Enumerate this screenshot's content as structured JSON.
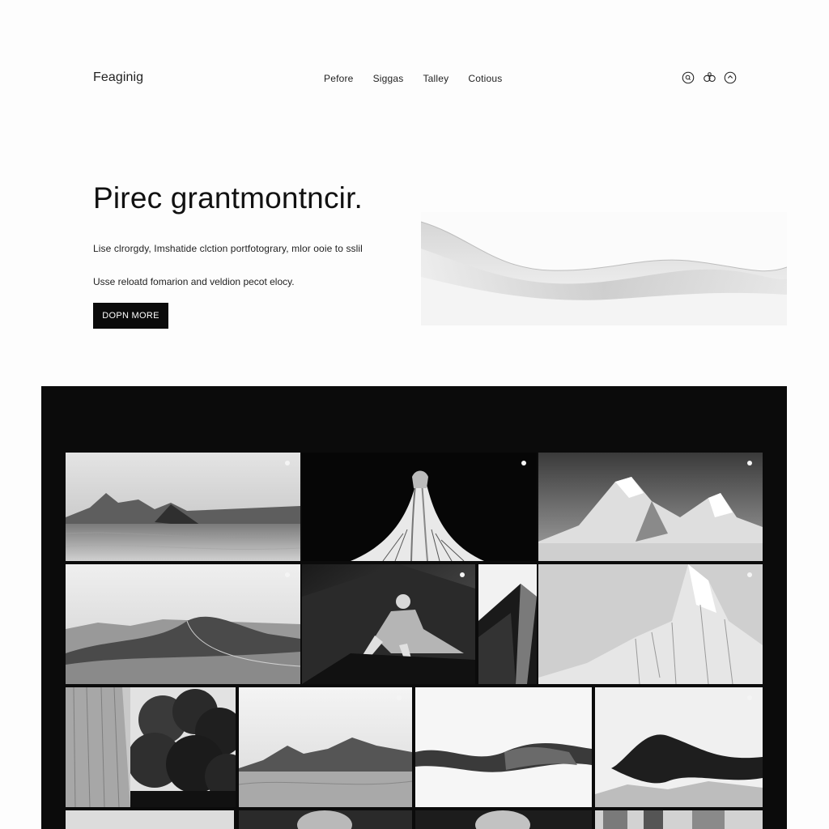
{
  "brand": {
    "logo_text": "Feaginig"
  },
  "nav": {
    "items": [
      {
        "label": "Pefore"
      },
      {
        "label": "Siggas"
      },
      {
        "label": "Talley"
      },
      {
        "label": "Cotious"
      }
    ],
    "icons": [
      "search-icon",
      "user-icon",
      "heart-icon"
    ]
  },
  "hero": {
    "title": "Pirec grantmontncir.",
    "subtitle_1": "Lise clrorgdy,  Imshatide clction portfotograry, mlor ooie to sslil",
    "subtitle_2": "Usse reloatd fomarion and veldion pecot elocy.",
    "cta_label": "DOPN MORE"
  },
  "gallery": {
    "tiles": [
      {
        "subject": "desert dunes"
      },
      {
        "subject": "modern architecture"
      },
      {
        "subject": "snowy mountains"
      },
      {
        "subject": "sand dunes"
      },
      {
        "subject": "sculpture"
      },
      {
        "subject": "angular building"
      },
      {
        "subject": "rocky peak"
      },
      {
        "subject": "cliff wall"
      },
      {
        "subject": "forest"
      },
      {
        "subject": "dunes"
      },
      {
        "subject": "fabric wave"
      },
      {
        "subject": "floating fabric"
      },
      {
        "subject": "portrait"
      },
      {
        "subject": "portrait"
      },
      {
        "subject": "city buildings"
      }
    ]
  },
  "colors": {
    "background": "#fdfdfd",
    "gallery_bg": "#0b0b0b",
    "cta_bg": "#0b0b0b",
    "text": "#111111"
  }
}
